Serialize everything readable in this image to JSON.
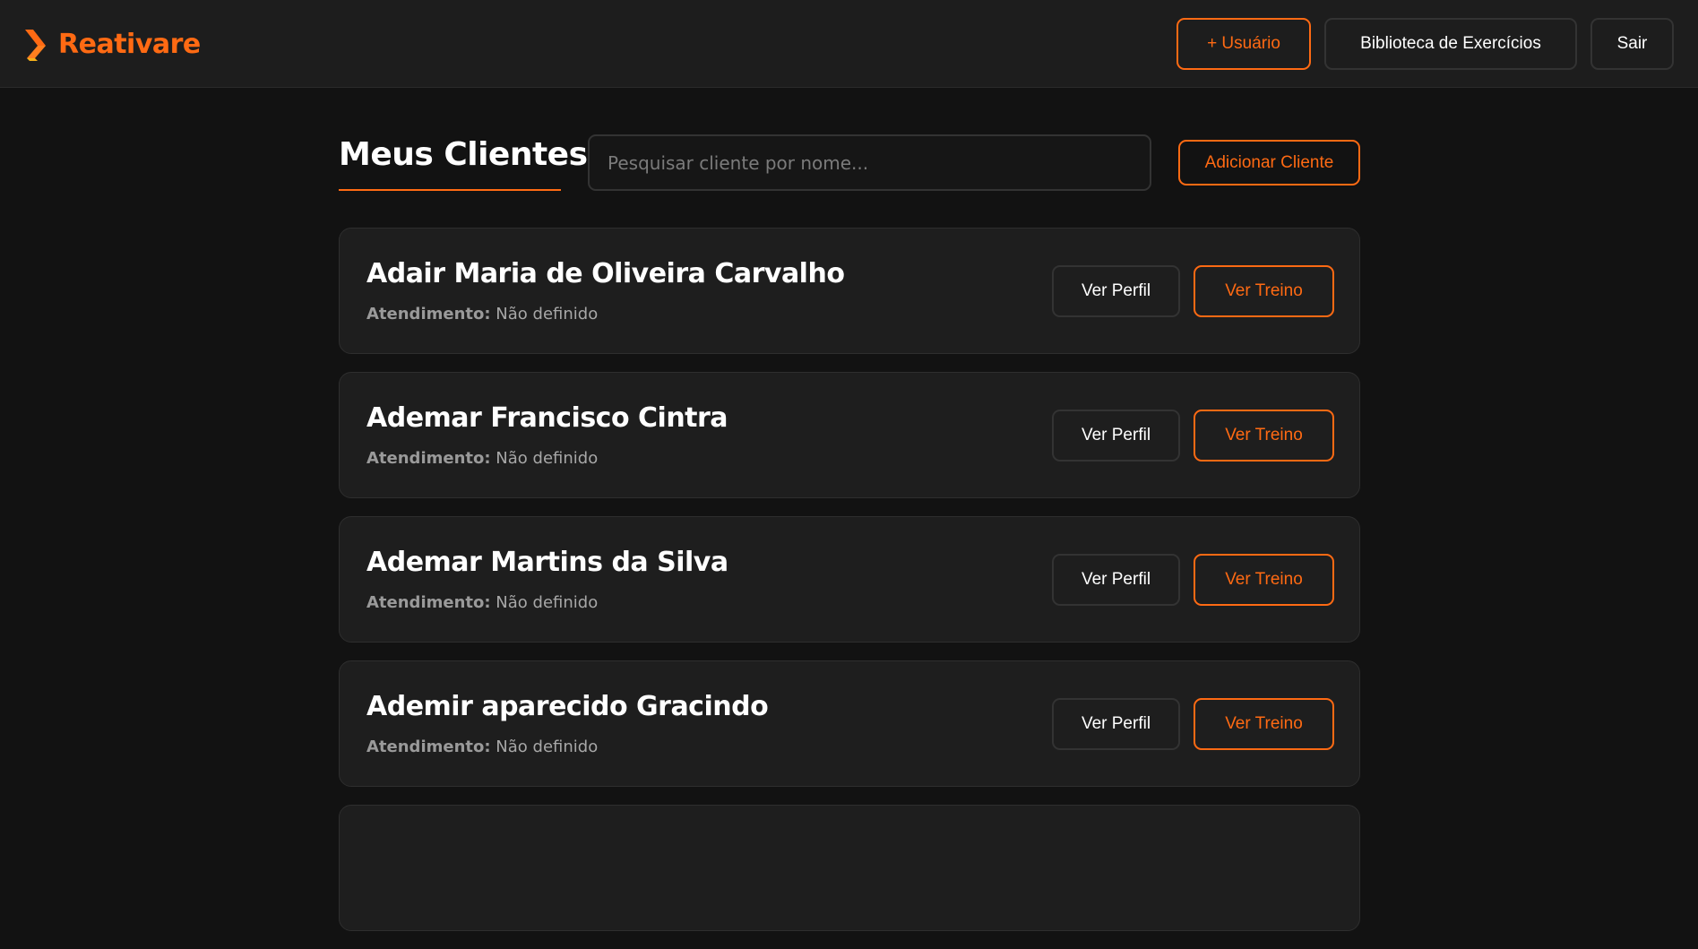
{
  "app": {
    "name": "Reativare",
    "accent_color": "#ff6a13",
    "logo_icon": "reativare-logo-icon"
  },
  "nav": {
    "add_user_label": "+ Usuário",
    "library_label": "Biblioteca de Exercícios",
    "logout_label": "Sair"
  },
  "main": {
    "title": "Meus Clientes",
    "search_placeholder": "Pesquisar cliente por nome...",
    "search_value": "",
    "add_client_label": "Adicionar Cliente"
  },
  "clients": [
    {
      "name": "Adair Maria de Oliveira Carvalho",
      "meta_label": "Atendimento:",
      "meta_value": "Não definido",
      "profile_label": "Ver Perfil",
      "training_label": "Ver Treino"
    },
    {
      "name": "Ademar Francisco Cintra",
      "meta_label": "Atendimento:",
      "meta_value": "Não definido",
      "profile_label": "Ver Perfil",
      "training_label": "Ver Treino"
    },
    {
      "name": "Ademar Martins da Silva",
      "meta_label": "Atendimento:",
      "meta_value": "Não definido",
      "profile_label": "Ver Perfil",
      "training_label": "Ver Treino"
    },
    {
      "name": "Ademir aparecido Gracindo",
      "meta_label": "Atendimento:",
      "meta_value": "Não definido",
      "profile_label": "Ver Perfil",
      "training_label": "Ver Treino"
    }
  ]
}
